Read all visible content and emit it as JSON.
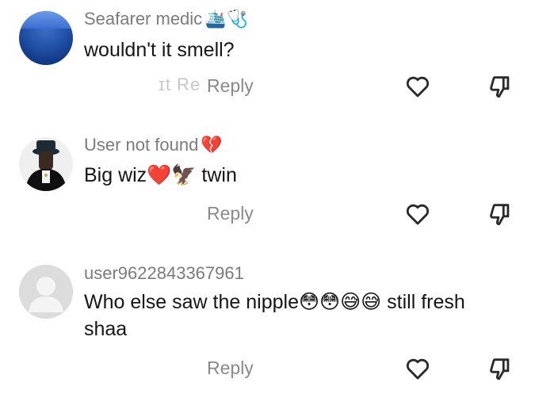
{
  "comments": [
    {
      "username": "Seafarer medic",
      "badges": "🛳️🩺",
      "text": "wouldn't it smell?",
      "ghost_text": "ɪt Re",
      "reply_label": "Reply",
      "avatar": "ocean-avatar"
    },
    {
      "username": "User not found",
      "badges": "💔",
      "text": "Big wiz❤️🦅 twin",
      "ghost_text": "",
      "reply_label": "Reply",
      "avatar": "person-avatar"
    },
    {
      "username": "user9622843367961",
      "badges": "",
      "text": "Who else saw the nipple😳😳😅😅 still fresh shaa",
      "ghost_text": "",
      "reply_label": "Reply",
      "avatar": "default-avatar"
    }
  ],
  "icons": {
    "like": "heart-icon",
    "dislike": "thumbs-down-icon"
  },
  "colors": {
    "username": "#7b7b7b",
    "text": "#161616",
    "reply": "#8a8a8a",
    "icon": "#2a2a2a"
  }
}
